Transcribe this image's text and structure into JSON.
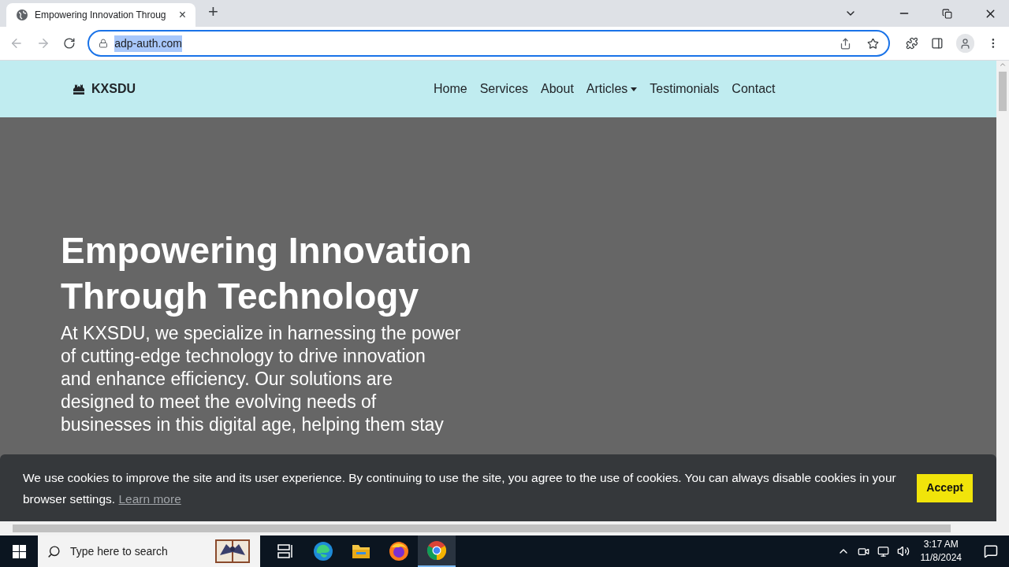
{
  "browser": {
    "tab": {
      "title": "Empowering Innovation Throug",
      "close": "×"
    },
    "new_tab": "+",
    "address": "adp-auth.com"
  },
  "navbar": {
    "brand": "KXSDU",
    "links": [
      {
        "label": "Home",
        "kind": "link"
      },
      {
        "label": "Services",
        "kind": "link"
      },
      {
        "label": "About",
        "kind": "link"
      },
      {
        "label": "Articles",
        "kind": "dropdown"
      },
      {
        "label": "Testimonials",
        "kind": "link"
      },
      {
        "label": "Contact",
        "kind": "link"
      }
    ]
  },
  "hero": {
    "heading": "Empowering Innovation Through Technology",
    "text": "At KXSDU, we specialize in harnessing the power\nof cutting-edge technology to drive innovation\nand enhance efficiency. Our solutions are\ndesigned to meet the evolving needs of\nbusinesses in this digital age, helping them stay"
  },
  "cookie_banner": {
    "message": "We use cookies to improve the site and its user experience. By continuing to use the site, you agree to the use of cookies. You can always disable cookies in your browser settings.",
    "link": "Learn more",
    "button": "Accept"
  },
  "taskbar": {
    "search_placeholder": "Type here to search",
    "apps": [
      {
        "kind": "taskview",
        "selected": false
      },
      {
        "kind": "edge",
        "selected": false
      },
      {
        "kind": "explorer",
        "selected": false
      },
      {
        "kind": "firefox",
        "selected": false
      },
      {
        "kind": "chrome",
        "selected": true
      }
    ],
    "time": "3:17 AM",
    "date": "11/8/2024"
  }
}
